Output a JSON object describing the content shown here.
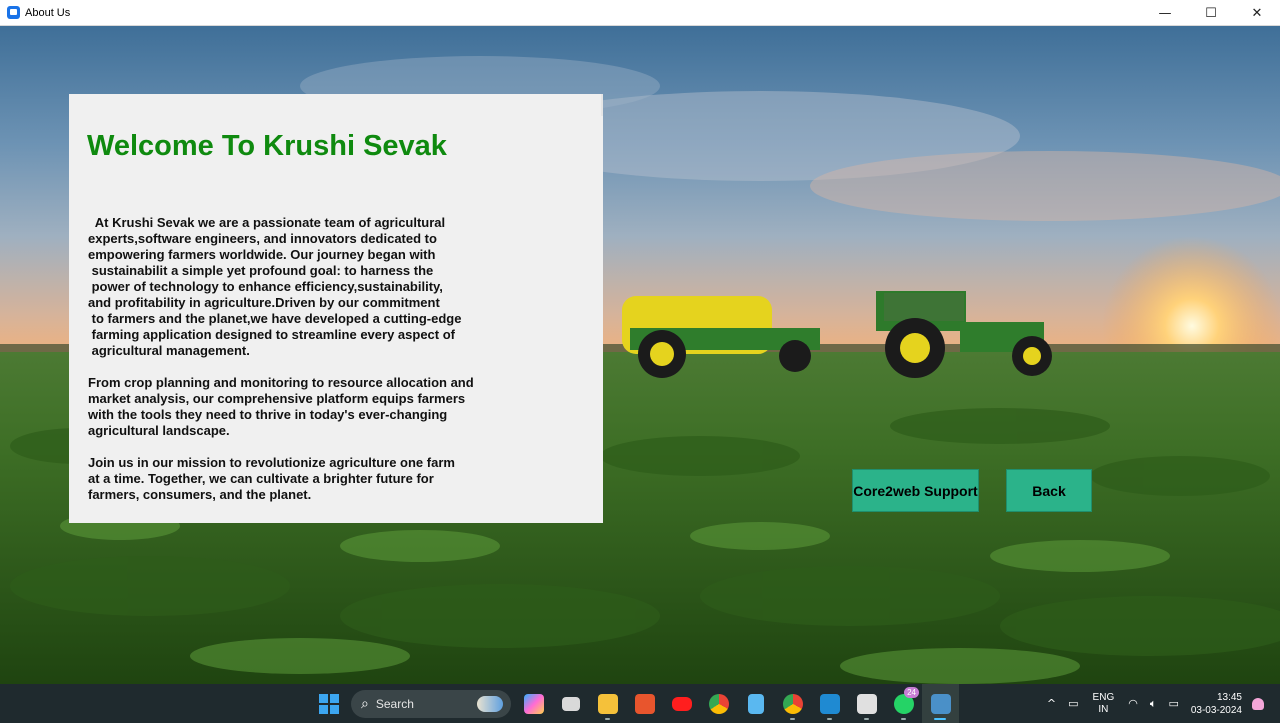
{
  "window": {
    "title": "About Us",
    "minimize": "—",
    "maximize": "☐",
    "close": "✕"
  },
  "card": {
    "title": "Welcome To Krushi Sevak",
    "body": "  At Krushi Sevak we are a passionate team of agricultural\nexperts,software engineers, and innovators dedicated to\nempowering farmers worldwide. Our journey began with\n sustainabilit a simple yet profound goal: to harness the\n power of technology to enhance efficiency,sustainability,\nand profitability in agriculture.Driven by our commitment\n to farmers and the planet,we have developed a cutting-edge\n farming application designed to streamline every aspect of\n agricultural management.\n\nFrom crop planning and monitoring to resource allocation and\nmarket analysis, our comprehensive platform equips farmers\nwith the tools they need to thrive in today's ever-changing\nagricultural landscape.\n\nJoin us in our mission to revolutionize agriculture one farm\nat a time. Together, we can cultivate a brighter future for\nfarmers, consumers, and the planet."
  },
  "buttons": {
    "support": "Core2web Support",
    "back": "Back"
  },
  "taskbar": {
    "search_label": "Search",
    "whatsapp_badge": "24",
    "language_line1": "ENG",
    "language_line2": "IN",
    "time": "13:45",
    "date": "03-03-2024"
  },
  "colors": {
    "title_green": "#0f8a0f",
    "button_teal": "#2bb38a"
  }
}
